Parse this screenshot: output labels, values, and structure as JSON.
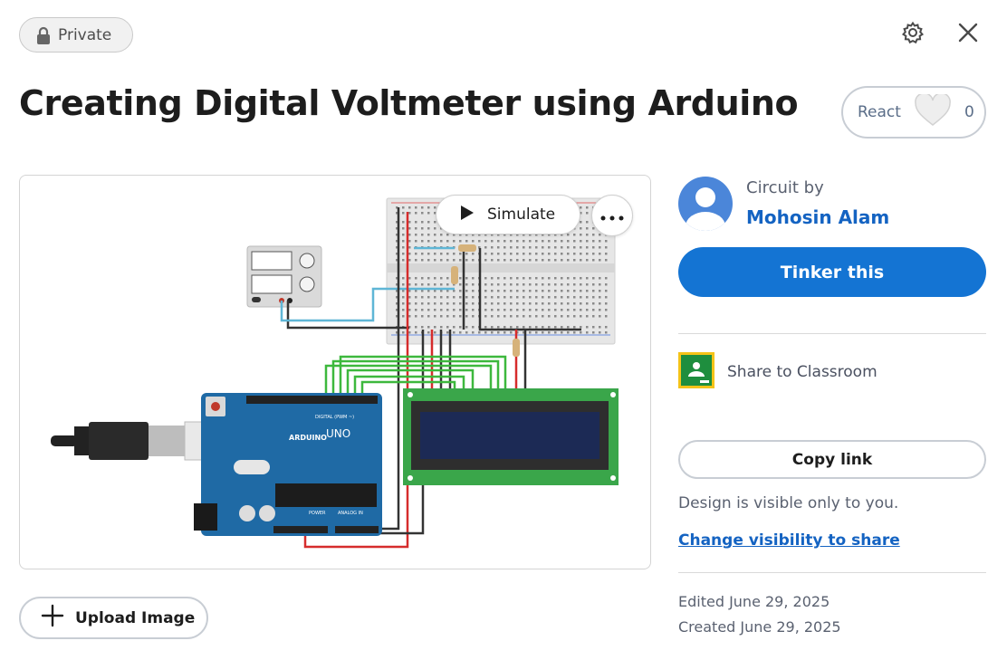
{
  "header": {
    "privacy_label": "Private",
    "title": "Creating Digital Voltmeter using Arduino",
    "react_label": "React",
    "react_count": "0"
  },
  "canvas": {
    "simulate_label": "Simulate",
    "arduino_brand": "ARDUINO",
    "arduino_model": "UNO",
    "digital_label": "DIGITAL (PWM ~)",
    "power_label": "POWER",
    "analog_label": "ANALOG IN"
  },
  "upload_label": "Upload Image",
  "sidebar": {
    "circuit_by": "Circuit by",
    "author": "Mohosin Alam",
    "tinker_label": "Tinker this",
    "classroom_label": "Share to Classroom",
    "copy_link_label": "Copy link",
    "visibility_text": "Design is visible only to you.",
    "visibility_link": "Change visibility to share",
    "edited": "Edited June 29, 2025",
    "created": "Created June 29, 2025"
  },
  "colors": {
    "accent": "#1474d3",
    "link": "#1463c2",
    "arduino_board": "#1f6aa5",
    "lcd_board": "#3aa64a",
    "lcd_screen": "#1c2a55"
  },
  "icons": [
    "lock-icon",
    "gear-icon",
    "close-icon",
    "heart-icon",
    "play-icon",
    "more-icon",
    "plus-icon",
    "avatar-icon",
    "classroom-icon"
  ]
}
